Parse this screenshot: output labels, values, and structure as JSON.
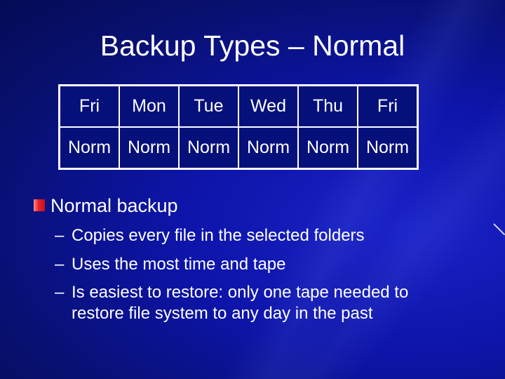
{
  "slide": {
    "title": "Backup Types – Normal",
    "table": {
      "days": [
        "Fri",
        "Mon",
        "Tue",
        "Wed",
        "Thu",
        "Fri"
      ],
      "backup_types": [
        "Norm",
        "Norm",
        "Norm",
        "Norm",
        "Norm",
        "Norm"
      ]
    },
    "bullet": {
      "icon": "red-square-bullet",
      "text": "Normal backup",
      "sub_bullets": [
        {
          "dash": "–",
          "text": "Copies every file in the selected folders"
        },
        {
          "dash": "–",
          "text": "Uses the most time and tape"
        },
        {
          "dash": "–",
          "text": "Is easiest to restore: only one tape needed to",
          "continuation": "restore file system to any day in the past"
        }
      ]
    }
  }
}
